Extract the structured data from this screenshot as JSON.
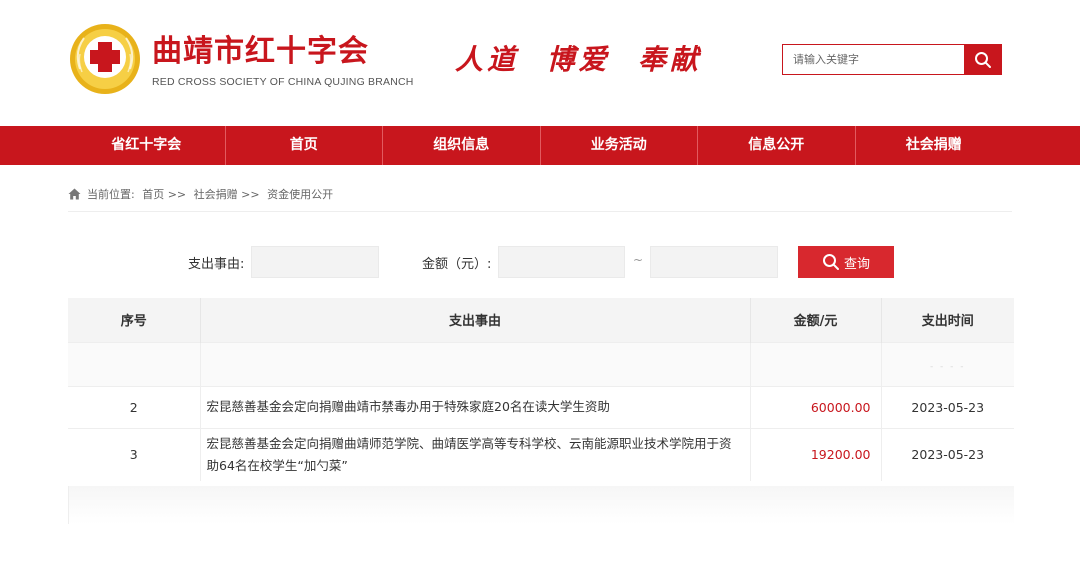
{
  "header": {
    "site_name": "曲靖市红十字会",
    "site_name_en": "RED CROSS SOCIETY OF CHINA QUJING BRANCH",
    "slogan": "人道  博爱  奉献",
    "search": {
      "placeholder": "请输入关键字",
      "icon": "search-icon"
    }
  },
  "nav": {
    "items": [
      {
        "label": "省红十字会"
      },
      {
        "label": "首页"
      },
      {
        "label": "组织信息"
      },
      {
        "label": "业务活动"
      },
      {
        "label": "信息公开"
      },
      {
        "label": "社会捐赠"
      }
    ]
  },
  "breadcrumb": {
    "prefix": "当前位置:",
    "items": [
      "首页 >>",
      "社会捐赠 >>",
      "资金使用公开"
    ]
  },
  "filter": {
    "reason_label": "支出事由:",
    "amount_label": "金额（元）:",
    "range_sep": "~",
    "query_label": "查询"
  },
  "table": {
    "headers": [
      "序号",
      "支出事由",
      "金额/元",
      "支出时间"
    ],
    "faded_row": {
      "time": "- - - -"
    },
    "rows": [
      {
        "no": "2",
        "reason": "宏昆慈善基金会定向捐赠曲靖市禁毒办用于特殊家庭20名在读大学生资助",
        "amount": "60000.00",
        "time": "2023-05-23"
      },
      {
        "no": "3",
        "reason": "宏昆慈善基金会定向捐赠曲靖师范学院、曲靖医学高等专科学校、云南能源职业技术学院用于资助64名在校学生“加勺菜”",
        "amount": "19200.00",
        "time": "2023-05-23"
      }
    ]
  },
  "colors": {
    "brand_red": "#c8161d",
    "logo_gold": "#e8b21a"
  }
}
